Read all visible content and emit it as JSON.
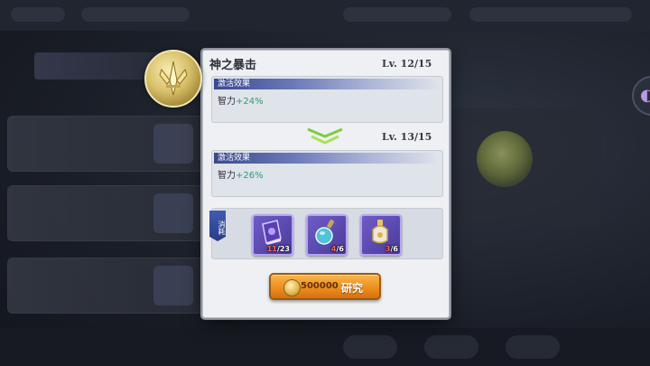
{
  "skill": {
    "title": "神之暴击",
    "current": {
      "level_text": "Lv.  12/15",
      "effect_header": "激活效果",
      "stat_label": "智力",
      "stat_value": "+24%"
    },
    "next": {
      "level_text": "Lv.  13/15",
      "effect_header": "激活效果",
      "stat_label": "智力",
      "stat_value": "+26%"
    }
  },
  "consume": {
    "label": "消耗",
    "items": [
      {
        "icon": "purple-book-icon",
        "have": "11",
        "need": "/23"
      },
      {
        "icon": "blue-potion-bottle-icon",
        "have": "4",
        "need": "/6"
      },
      {
        "icon": "golden-bottle-icon",
        "have": "3",
        "need": "/6"
      }
    ]
  },
  "research_button": {
    "cost": "500000",
    "label": "研究",
    "icon": "gold-coin-icon"
  },
  "colors": {
    "value_green": "#2e9a78",
    "button_orange": "#ec8f1f",
    "shortage_red": "#ff6a5a"
  }
}
